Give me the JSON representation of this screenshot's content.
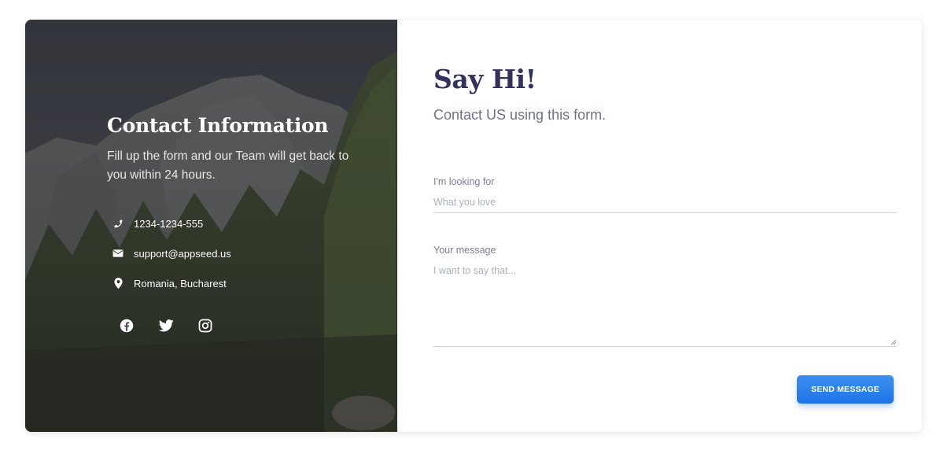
{
  "left_panel": {
    "title": "Contact Information",
    "description": "Fill up the form and our Team will get back to you within 24 hours.",
    "contacts": [
      {
        "icon": "phone-icon",
        "text": "1234-1234-555"
      },
      {
        "icon": "envelope-icon",
        "text": "support@appseed.us"
      },
      {
        "icon": "map-pin-icon",
        "text": "Romania, Bucharest"
      }
    ],
    "socials": [
      "facebook-icon",
      "twitter-icon",
      "instagram-icon"
    ]
  },
  "right_panel": {
    "title": "Say Hi!",
    "subtitle": "Contact US using this form.",
    "looking_for": {
      "label": "I'm looking for",
      "placeholder": "What you love",
      "value": ""
    },
    "message": {
      "label": "Your message",
      "placeholder": "I want to say that...",
      "value": ""
    },
    "submit_label": "SEND MESSAGE"
  },
  "colors": {
    "heading": "#32325d",
    "muted": "#6b7289",
    "button": "#1d74e6"
  }
}
